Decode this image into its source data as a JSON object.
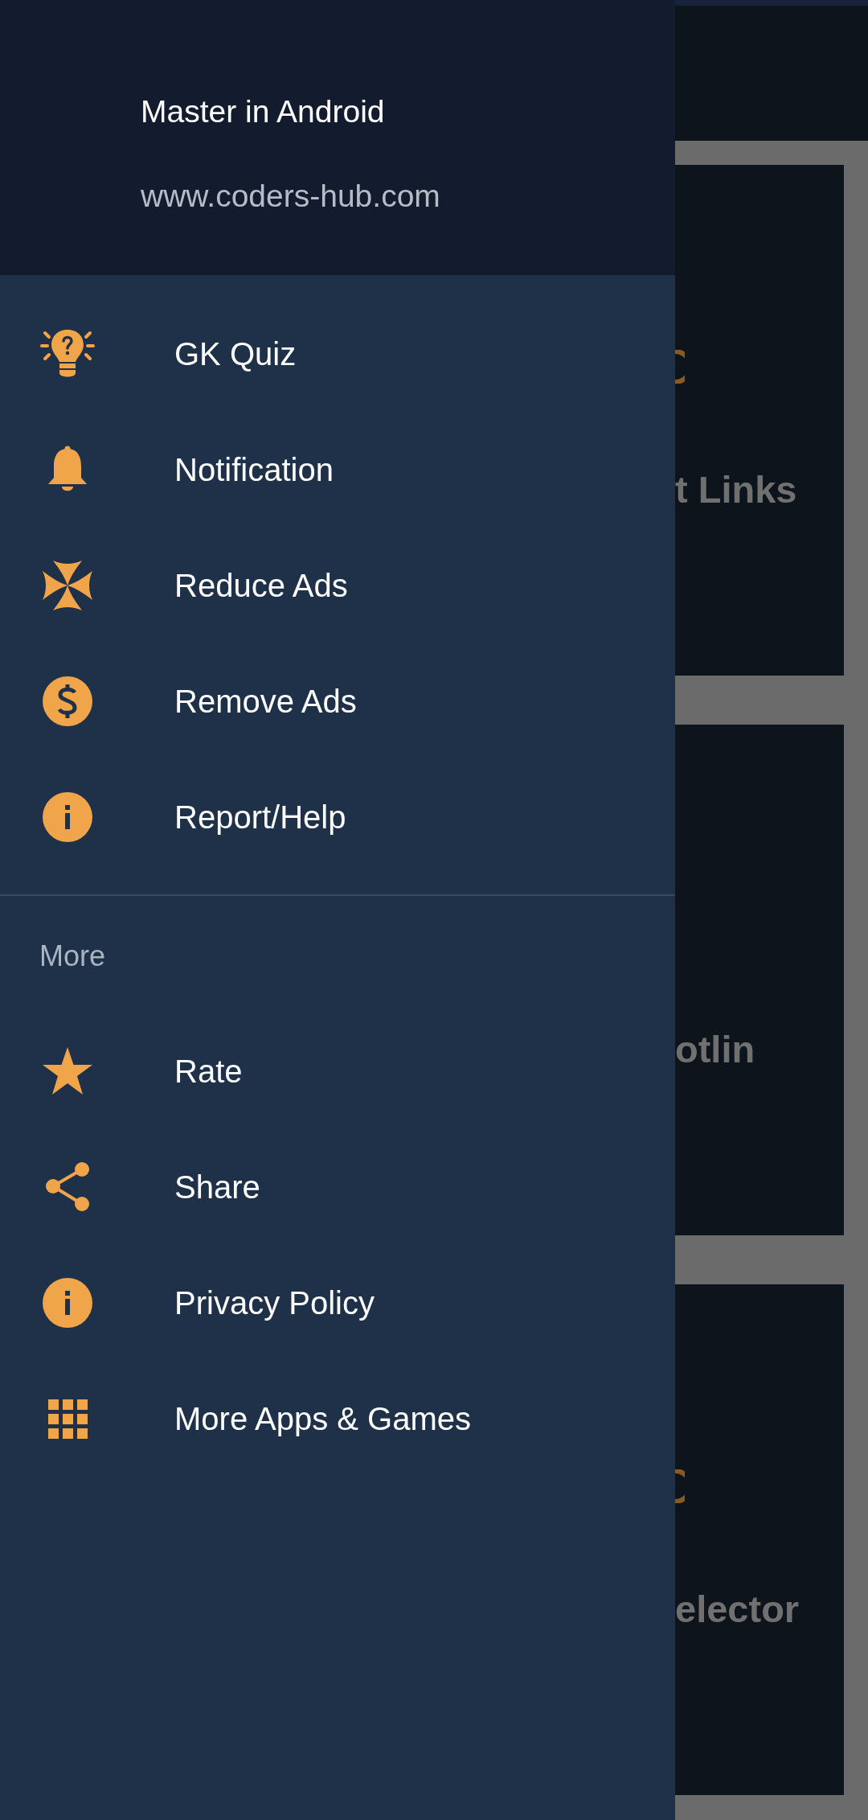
{
  "drawer": {
    "header": {
      "title": "Master in Android",
      "subtitle": "www.coders-hub.com"
    },
    "items": [
      {
        "label": "GK Quiz"
      },
      {
        "label": "Notification"
      },
      {
        "label": "Reduce Ads"
      },
      {
        "label": "Remove Ads"
      },
      {
        "label": "Report/Help"
      }
    ],
    "more": {
      "heading": "More",
      "items": [
        {
          "label": "Rate"
        },
        {
          "label": "Share"
        },
        {
          "label": "Privacy Policy"
        },
        {
          "label": "More Apps & Games"
        }
      ]
    }
  },
  "background": {
    "cards": [
      {
        "title": "t Links",
        "ring": true
      },
      {
        "title": "otlin",
        "ring": false
      },
      {
        "title": "elector",
        "ring": true
      }
    ]
  }
}
